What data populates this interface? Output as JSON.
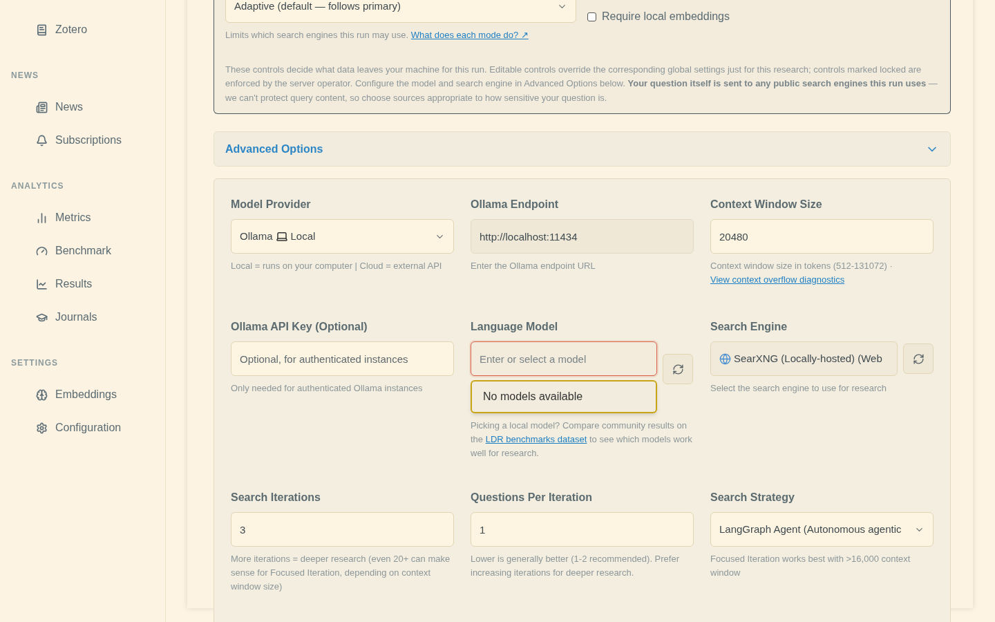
{
  "sidebar": {
    "sections": [
      {
        "items": [
          {
            "label": "Zotero"
          }
        ]
      },
      {
        "heading": "NEWS",
        "items": [
          {
            "label": "News"
          },
          {
            "label": "Subscriptions"
          }
        ]
      },
      {
        "heading": "ANALYTICS",
        "items": [
          {
            "label": "Metrics"
          },
          {
            "label": "Benchmark"
          },
          {
            "label": "Results"
          },
          {
            "label": "Journals"
          }
        ]
      },
      {
        "heading": "SETTINGS",
        "items": [
          {
            "label": "Embeddings"
          },
          {
            "label": "Configuration"
          }
        ]
      }
    ]
  },
  "privacy": {
    "mode_select": "Adaptive (default — follows primary)",
    "require_local_embeddings": {
      "label": "Require local embeddings",
      "checked": false
    },
    "hint": "Limits which search engines this run may use.",
    "hint_link": "What does each mode do? ↗",
    "notice": "These controls decide what data leaves your machine for this run. Editable controls override the corresponding global settings just for this research; controls marked locked are enforced by the server operator. Configure the model and search engine in Advanced Options below. **Your question itself is sent to any public search engines this run uses** — we can't protect query content, so choose sources appropriate to how sensitive your question is."
  },
  "advanced": {
    "title": "Advanced Options",
    "expanded": true
  },
  "fields": [
    {
      "kind": "select",
      "label": "Model Provider",
      "value": "Ollama",
      "value_suffix": "Local",
      "help": "Local = runs on your computer | Cloud = external API"
    },
    {
      "kind": "input",
      "label": "Ollama Endpoint",
      "value": "http://localhost:11434",
      "disabled": true,
      "help": "Enter the Ollama endpoint URL"
    },
    {
      "kind": "input",
      "label": "Context Window Size",
      "value": "20480",
      "disabled": false,
      "help": "Context window size in tokens (512-131072) · ",
      "link": "View context overflow diagnostics"
    },
    {
      "kind": "input",
      "label": "Ollama API Key (Optional)",
      "placeholder": "Optional, for authenticated instances",
      "disabled": false,
      "help": "Only needed for authenticated Ollama instances"
    },
    {
      "kind": "combo",
      "label": "Language Model",
      "placeholder": "Enter or select a model",
      "invalid": true,
      "dropdown": "No models available",
      "help": "Picking a local model? Compare community results on the ",
      "link": "LDR benchmarks dataset",
      "help_after": " to see which models work well for research."
    },
    {
      "kind": "engine",
      "label": "Search Engine",
      "value": "SearXNG (Locally-hosted) (Web",
      "help": "Select the search engine to use for research"
    },
    {
      "kind": "input",
      "label": "Search Iterations",
      "value": "3",
      "disabled": false,
      "help": "More iterations = deeper research (even 20+ can make sense for Focused Iteration, depending on context window size)"
    },
    {
      "kind": "input",
      "label": "Questions Per Iteration",
      "value": "1",
      "disabled": false,
      "help": "Lower is generally better (1-2 recommended). Prefer increasing iterations for deeper research."
    },
    {
      "kind": "select",
      "label": "Search Strategy",
      "value": "LangGraph Agent (Autonomous agentic",
      "help": "Focused Iteration works best with >16,000 context window"
    }
  ]
}
